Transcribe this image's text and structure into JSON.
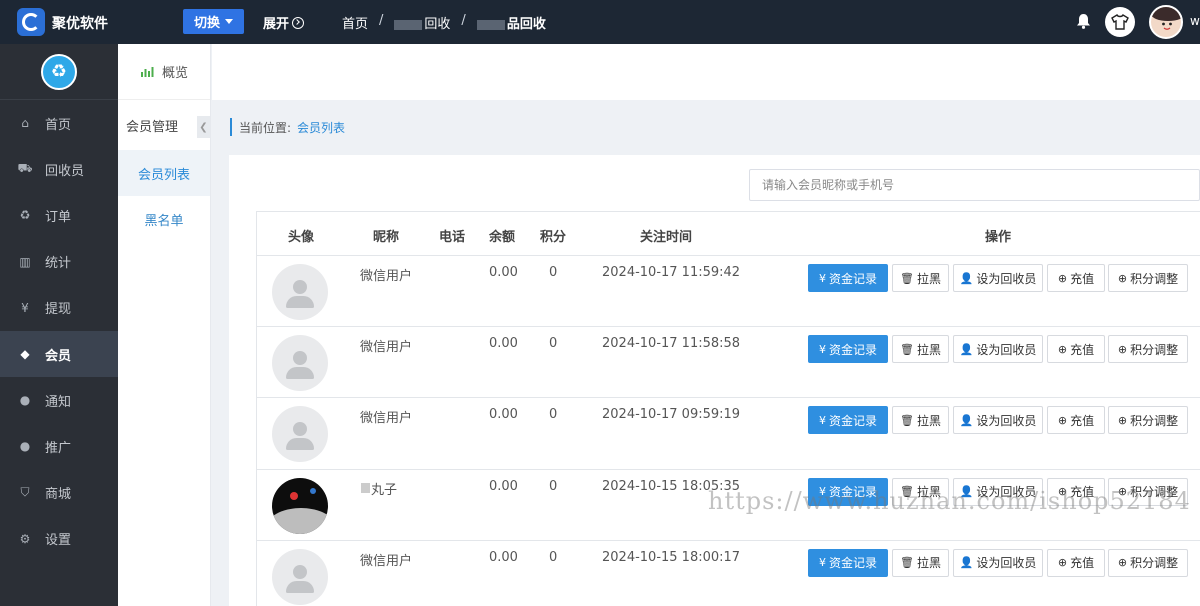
{
  "topbar": {
    "brand": "聚优软件",
    "switch_label": "切换",
    "expand_label": "展开",
    "breadcrumb": [
      "首页",
      "回收",
      "品回收"
    ],
    "username": "w"
  },
  "sidebar": {
    "items": [
      {
        "label": "首页",
        "icon": "home-icon",
        "glyph": "⌂"
      },
      {
        "label": "回收员",
        "icon": "truck-icon",
        "glyph": "⛟"
      },
      {
        "label": "订单",
        "icon": "recycle-icon",
        "glyph": "♻"
      },
      {
        "label": "统计",
        "icon": "bar-chart-icon",
        "glyph": "▥"
      },
      {
        "label": "提现",
        "icon": "yen-icon",
        "glyph": "¥"
      },
      {
        "label": "会员",
        "icon": "tag-icon",
        "glyph": "◆",
        "active": true
      },
      {
        "label": "通知",
        "icon": "comments-icon",
        "glyph": "●"
      },
      {
        "label": "推广",
        "icon": "comments-icon",
        "glyph": "●"
      },
      {
        "label": "商城",
        "icon": "cart-icon",
        "glyph": "⛉"
      },
      {
        "label": "设置",
        "icon": "gear-icon",
        "glyph": "⚙"
      }
    ]
  },
  "subsidebar": {
    "overview": "概览",
    "group": "会员管理",
    "items": [
      "会员列表",
      "黑名单"
    ]
  },
  "location": {
    "prefix": "当前位置:",
    "current": "会员列表"
  },
  "search": {
    "placeholder": "请输入会员昵称或手机号"
  },
  "table": {
    "headers": [
      "头像",
      "昵称",
      "电话",
      "余额",
      "积分",
      "关注时间",
      "操作"
    ],
    "actions": {
      "funds": "资金记录",
      "blacklist": "拉黑",
      "set_recycler": "设为回收员",
      "recharge": "充值",
      "points": "积分调整"
    },
    "rows": [
      {
        "avatar": "default",
        "nickname": "微信用户",
        "phone": "",
        "balance": "0.00",
        "points": "0",
        "time": "2024-10-17 11:59:42"
      },
      {
        "avatar": "default",
        "nickname": "微信用户",
        "phone": "",
        "balance": "0.00",
        "points": "0",
        "time": "2024-10-17 11:58:58"
      },
      {
        "avatar": "default",
        "nickname": "微信用户",
        "phone": "",
        "balance": "0.00",
        "points": "0",
        "time": "2024-10-17 09:59:19"
      },
      {
        "avatar": "photo",
        "nickname": "丸子",
        "phone": "",
        "balance": "0.00",
        "points": "0",
        "time": "2024-10-15 18:05:35"
      },
      {
        "avatar": "default",
        "nickname": "微信用户",
        "phone": "",
        "balance": "0.00",
        "points": "0",
        "time": "2024-10-15 18:00:17"
      }
    ]
  },
  "watermark": "https://www.huzhan.com/ishop52184",
  "colors": {
    "topbar": "#1d2734",
    "sidebar": "#2b2f36",
    "primary": "#2f8fe0",
    "switch_button": "#2f73e3"
  }
}
